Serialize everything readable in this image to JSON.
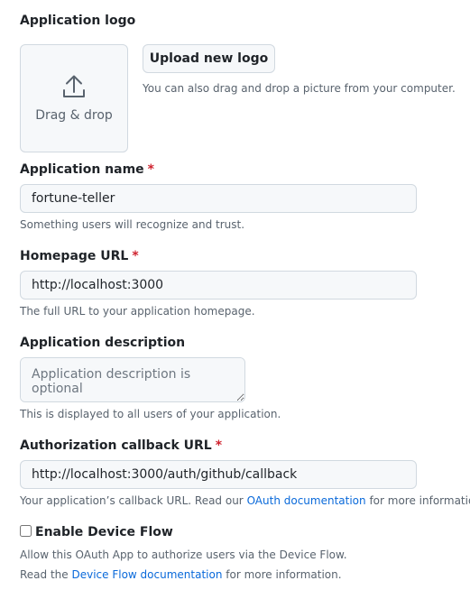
{
  "logo_section": {
    "label": "Application logo",
    "dropzone_text": "Drag & drop",
    "upload_button": "Upload new logo",
    "hint": "You can also drag and drop a picture from your computer."
  },
  "app_name": {
    "label": "Application name",
    "required_mark": "*",
    "value": "fortune-teller",
    "note": "Something users will recognize and trust."
  },
  "homepage": {
    "label": "Homepage URL",
    "required_mark": "*",
    "value": "http://localhost:3000",
    "note": "The full URL to your application homepage."
  },
  "description": {
    "label": "Application description",
    "placeholder": "Application description is optional",
    "note": "This is displayed to all users of your application."
  },
  "callback": {
    "label": "Authorization callback URL",
    "required_mark": "*",
    "value": "http://localhost:3000/auth/github/callback",
    "note_prefix": "Your application’s callback URL. Read our ",
    "note_link": "OAuth documentation",
    "note_suffix": " for more information."
  },
  "device_flow": {
    "label": "Enable Device Flow",
    "checked": false,
    "note_line1": "Allow this OAuth App to authorize users via the Device Flow.",
    "note_line2_prefix": "Read the ",
    "note_line2_link": "Device Flow documentation",
    "note_line2_suffix": " for more information."
  }
}
